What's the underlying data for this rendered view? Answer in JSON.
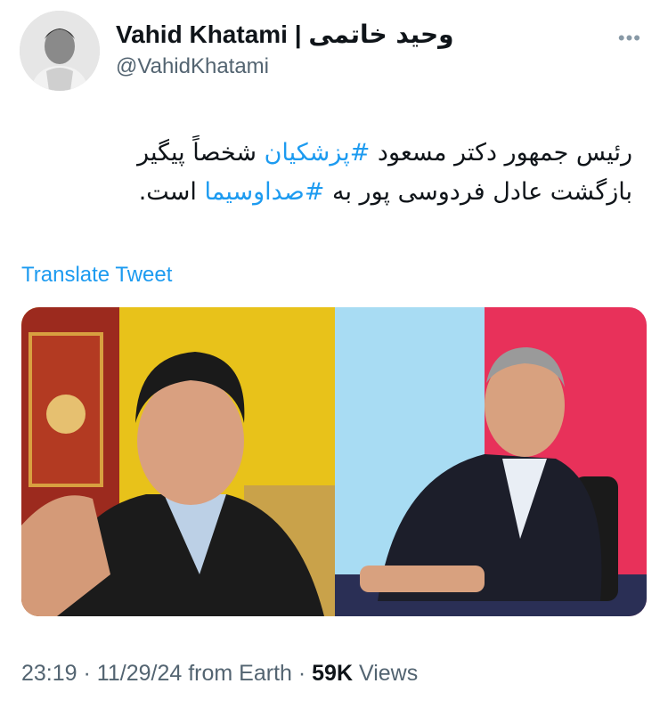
{
  "author": {
    "name": "Vahid Khatami",
    "separator": "|",
    "name_fa": "وحید خاتمی",
    "handle": "@VahidKhatami"
  },
  "tweet": {
    "text_part1": "رئیس جمهور دکتر مسعود ",
    "hashtag1": "#پزشکیان",
    "text_part2": " شخصاً پیگیر بازگشت عادل فردوسی پور به ",
    "hashtag2": "#صداوسیما",
    "text_part3": " است."
  },
  "translate_label": "Translate Tweet",
  "more_icon": "more-dots-icon",
  "meta": {
    "time": "23:19",
    "dot1": "·",
    "date": "11/29/24",
    "source": "from Earth",
    "dot2": "·",
    "views_count": "59K",
    "views_label": "Views"
  },
  "colors": {
    "link": "#1d9bf0",
    "muted": "#536471",
    "text": "#0f1419"
  }
}
